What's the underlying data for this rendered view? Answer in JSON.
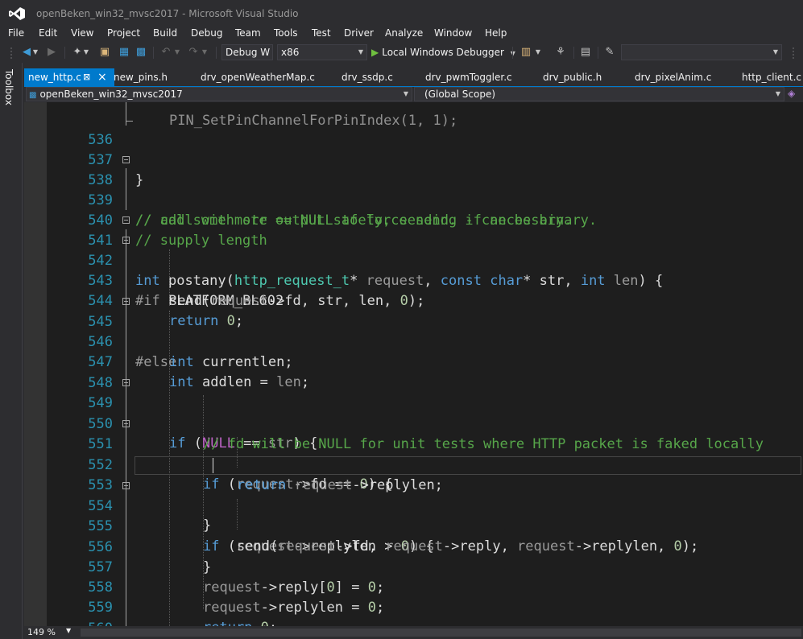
{
  "window": {
    "title": "openBeken_win32_mvsc2017 - Microsoft Visual Studio"
  },
  "menu": [
    "File",
    "Edit",
    "View",
    "Project",
    "Build",
    "Debug",
    "Team",
    "Tools",
    "Test",
    "Driver",
    "Analyze",
    "Window",
    "Help"
  ],
  "toolbar": {
    "config": "Debug W",
    "platform": "x86",
    "run_label": "Local Windows Debugger",
    "search_value": ""
  },
  "toolbox": {
    "label": "Toolbox"
  },
  "tabs": [
    {
      "label": "new_http.c",
      "active": true
    },
    {
      "label": "new_pins.h"
    },
    {
      "label": "drv_openWeatherMap.c"
    },
    {
      "label": "drv_ssdp.c"
    },
    {
      "label": "drv_pwmToggler.c"
    },
    {
      "label": "drv_public.h"
    },
    {
      "label": "drv_pixelAnim.c"
    },
    {
      "label": "http_client.c"
    }
  ],
  "navbar": {
    "project": "openBeken_win32_mvsc2017",
    "scope": "(Global Scope)"
  },
  "editor": {
    "lines": [
      {
        "n": "536"
      },
      {
        "n": "537"
      },
      {
        "n": "538"
      },
      {
        "n": "539"
      },
      {
        "n": "540"
      },
      {
        "n": "541"
      },
      {
        "n": "542"
      },
      {
        "n": "543"
      },
      {
        "n": "544"
      },
      {
        "n": "545"
      },
      {
        "n": "546"
      },
      {
        "n": "547"
      },
      {
        "n": "548"
      },
      {
        "n": "549"
      },
      {
        "n": "550"
      },
      {
        "n": "551"
      },
      {
        "n": "552"
      },
      {
        "n": "553"
      },
      {
        "n": "554"
      },
      {
        "n": "555"
      },
      {
        "n": "556"
      },
      {
        "n": "557"
      },
      {
        "n": "558"
      },
      {
        "n": "559"
      },
      {
        "n": "560"
      }
    ],
    "code": {
      "l536": "}",
      "l538": "// add some more output safely, sending if necessary.",
      "l539": "// call with str == NULL to force send. - can be binary.",
      "l540": "// supply length",
      "l541_int": "int",
      "l541_name": "postany(",
      "l541_type": "http_request_t",
      "l541_rest1": "* ",
      "l541_p1": "request",
      "l541_c": ", ",
      "l541_const": "const",
      "l541_char": "char",
      "l541_rest2": "* str, ",
      "l541_int2": "int",
      "l541_len": "len",
      "l541_end": ") {",
      "l542_if": "#if",
      "l542_macro": "PLATFORM_BL602",
      "l543_a": "send(",
      "l543_b": "request",
      "l543_c": "->fd, str, len, ",
      "l543_d": "0",
      "l543_e": ");",
      "l544_kw": "return",
      "l544_num": "0",
      "l544_end": ";",
      "l545": "#else",
      "l546_kw": "int",
      "l546_rest": "currentlen;",
      "l547_kw": "int",
      "l547_rest": "addlen = ",
      "l547_len": "len",
      "l547_end": ";",
      "l549_kw": "if",
      "l549_a": " (",
      "l549_null": "NULL",
      "l549_b": " == ",
      "l549_str": "str",
      "l549_c": ") {",
      "l550": "// fd will be NULL for unit tests where HTTP packet is faked locally",
      "l551_kw": "if",
      "l551_a": " (",
      "l551_req": "request",
      "l551_b": "->fd == ",
      "l551_num": "0",
      "l551_c": ") {",
      "l552_kw": "return",
      "l552_req": "request",
      "l552_rest": "->replylen;",
      "l553": "}",
      "l554_kw": "if",
      "l554_a": " (",
      "l554_req": "request",
      "l554_b": "->replylen > ",
      "l554_num": "0",
      "l554_c": ") {",
      "l555_a": "send(",
      "l555_r1": "request",
      "l555_b": "->fd, ",
      "l555_r2": "request",
      "l555_c": "->reply, ",
      "l555_r3": "request",
      "l555_d": "->replylen, ",
      "l555_num": "0",
      "l555_e": ");",
      "l556": "}",
      "l557_req": "request",
      "l557_a": "->reply[",
      "l557_n1": "0",
      "l557_b": "] = ",
      "l557_n2": "0",
      "l557_c": ";",
      "l558_req": "request",
      "l558_a": "->replylen = ",
      "l558_num": "0",
      "l558_b": ";",
      "l559_kw": "return",
      "l559_num": "0",
      "l559_end": ";",
      "l560": "}"
    }
  },
  "status": {
    "zoom": "149 %"
  }
}
